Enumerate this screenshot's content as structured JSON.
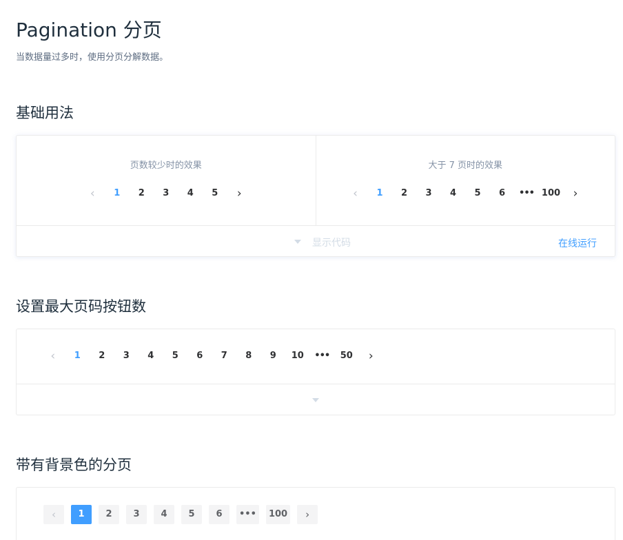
{
  "page": {
    "title": "Pagination 分页",
    "description": "当数据量过多时，使用分页分解数据。"
  },
  "sections": [
    {
      "title": "基础用法",
      "demos": [
        {
          "caption": "页数较少时的效果",
          "prev": "‹",
          "next": "›",
          "pages": [
            "1",
            "2",
            "3",
            "4",
            "5"
          ],
          "active": "1"
        },
        {
          "caption": "大于 7 页时的效果",
          "prev": "‹",
          "next": "›",
          "pages": [
            "1",
            "2",
            "3",
            "4",
            "5",
            "6",
            "•••",
            "100"
          ],
          "active": "1"
        }
      ],
      "show_code": "显示代码",
      "run_online": "在线运行"
    },
    {
      "title": "设置最大页码按钮数",
      "pager": {
        "prev": "‹",
        "next": "›",
        "pages": [
          "1",
          "2",
          "3",
          "4",
          "5",
          "6",
          "7",
          "8",
          "9",
          "10",
          "•••",
          "50"
        ],
        "active": "1"
      }
    },
    {
      "title": "带有背景色的分页",
      "pager": {
        "prev": "‹",
        "next": "›",
        "pages": [
          "1",
          "2",
          "3",
          "4",
          "5",
          "6",
          "•••",
          "100"
        ],
        "active": "1"
      }
    }
  ],
  "colors": {
    "accent": "#409eff",
    "text": "#303133",
    "muted": "#8492a6",
    "border": "#ebebeb",
    "disabled": "#c0c4cc",
    "bg_button": "#f4f4f5"
  }
}
